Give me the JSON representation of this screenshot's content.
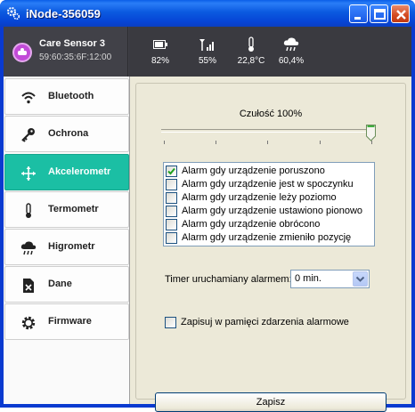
{
  "window": {
    "title": "iNode-356059"
  },
  "device": {
    "name": "Care Sensor 3",
    "mac": "59:60:35:6F:12:00"
  },
  "stats": [
    {
      "icon": "battery-icon",
      "value": "82%"
    },
    {
      "icon": "signal-icon",
      "value": "55%"
    },
    {
      "icon": "thermometer-icon",
      "value": "22,8°C"
    },
    {
      "icon": "cloud-rain-icon",
      "value": "60,4%"
    }
  ],
  "nav": [
    {
      "icon": "wifi-icon",
      "label": "Bluetooth"
    },
    {
      "icon": "key-icon",
      "label": "Ochrona"
    },
    {
      "icon": "move-icon",
      "label": "Akcelerometr",
      "active": true
    },
    {
      "icon": "thermometer-icon",
      "label": "Termometr"
    },
    {
      "icon": "cloud-rain-icon",
      "label": "Higrometr"
    },
    {
      "icon": "file-x-icon",
      "label": "Dane"
    },
    {
      "icon": "gear-icon",
      "label": "Firmware"
    }
  ],
  "accel": {
    "sensitivity_label": "Czułość 100%",
    "sensitivity_value": 100,
    "alarms": [
      {
        "label": "Alarm gdy urządzenie poruszono",
        "checked": true
      },
      {
        "label": "Alarm gdy urządzenie jest w spoczynku",
        "checked": false
      },
      {
        "label": "Alarm gdy urządzenie leży poziomo",
        "checked": false
      },
      {
        "label": "Alarm gdy urządzenie ustawiono pionowo",
        "checked": false
      },
      {
        "label": "Alarm gdy urządzenie obrócono",
        "checked": false
      },
      {
        "label": "Alarm gdy urządzenie zmieniło pozycję",
        "checked": false
      }
    ],
    "timer_label": "Timer uruchamiany alarmem:",
    "timer_value": "0 min.",
    "save_events_label": "Zapisuj w pamięci  zdarzenia alarmowe",
    "save_events_checked": false,
    "save_button": "Zapisz"
  },
  "colors": {
    "accent": "#1bbfa4",
    "header": "#414148",
    "titlebar": "#0a5ee8"
  }
}
